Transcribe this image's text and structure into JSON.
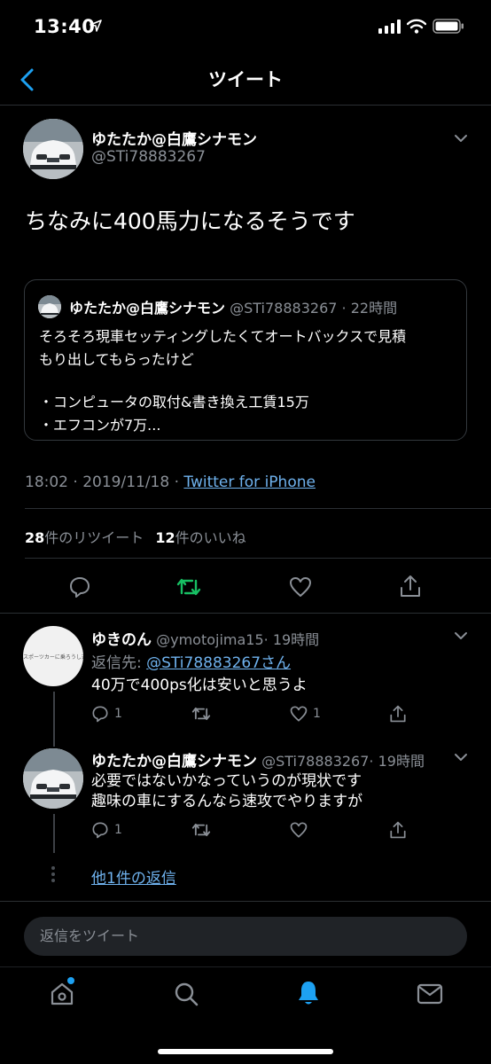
{
  "status_bar": {
    "time": "13:40"
  },
  "nav": {
    "title": "ツイート"
  },
  "tweet": {
    "author_name": "ゆたたか@白鷹シナモン",
    "author_handle": "@STi78883267",
    "text": "ちなみに400馬力になるそうです",
    "quote": {
      "author_name": "ゆたたか@白鷹シナモン",
      "author_handle": "@STi78883267",
      "time": "· 22時間",
      "lines": [
        "そろそろ現車セッティングしたくてオートバックスで見積",
        "もり出してもらったけど",
        "",
        "・コンピュータの取付&書き換え工賃15万",
        "・エフコンが7万..."
      ]
    },
    "timestamp": "18:02 · 2019/11/18 · ",
    "source": "Twitter for iPhone",
    "retweets_count": "28",
    "retweets_label": "件のリツイート",
    "likes_count": "12",
    "likes_label": "件のいいね"
  },
  "replies": [
    {
      "author_name": "ゆきのん",
      "author_handle": "@ymotojima15",
      "time": "· 19時間",
      "reply_to_label": "返信先: ",
      "reply_to_handle": "@STi78883267さん",
      "text": "40万で400ps化は安いと思うよ",
      "reply_count": "1",
      "like_count": "1",
      "avatar_text": "スポーツカーに乗ろうし逃う"
    },
    {
      "author_name": "ゆたたか@白鷹シナモン",
      "author_handle": "@STi78883267",
      "time": "· 19時間",
      "lines": [
        "必要ではないかなっていうのが現状です",
        "趣味の車にするんなら速攻でやりますが"
      ],
      "reply_count": "1"
    }
  ],
  "more_replies": "他1件の返信",
  "composer": {
    "placeholder": "返信をツイート"
  },
  "tab_bar": {
    "icons": [
      "home-icon",
      "search-icon",
      "notifications-icon",
      "messages-icon"
    ],
    "active": "notifications-icon",
    "badge_color": "#1da1f2"
  },
  "colors": {
    "accent": "#1da1f2",
    "retweet": "#17bf63",
    "background": "#000000"
  }
}
